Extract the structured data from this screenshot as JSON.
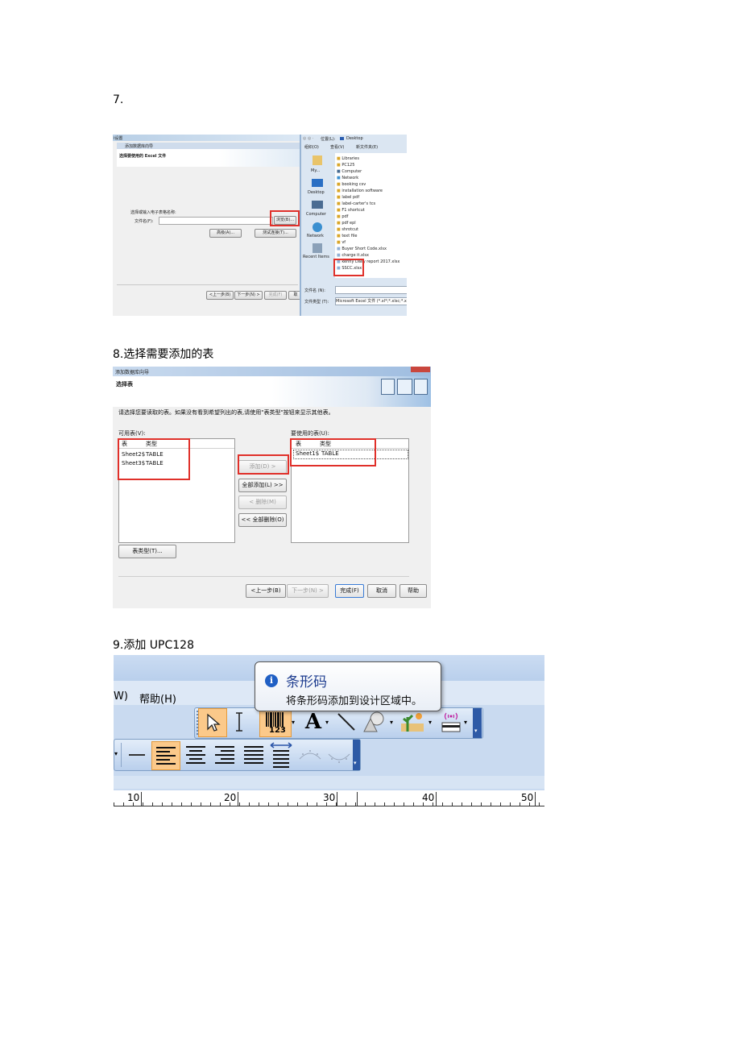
{
  "step7": {
    "label": "7.",
    "wizard": {
      "tab_fragment": "i设置",
      "title": "添加数据库向导",
      "heading": "选择要使用的 Excel 文件",
      "prompt": "选择或输入电子表格名称:",
      "filename_label": "文件名(F):",
      "browse": "浏览(B)...",
      "advanced": "高级(A)...",
      "test": "测试连接(T)...",
      "back": "<上一步(B)",
      "next": "下一步(N) >",
      "finish": "完成(F)",
      "cancel": "取"
    },
    "dialog": {
      "location_label": "位置(L):",
      "location": "Desktop",
      "organize": "组织(O)",
      "view": "查看(V)",
      "new_folder": "新文件夹(E)",
      "places": [
        "My...",
        "Desktop",
        "Computer",
        "Network",
        "Recent Items"
      ],
      "files": [
        "Libraries",
        "PC125",
        "Computer",
        "Network",
        "booking csv",
        "installation software",
        "label pdf",
        "label-carter's tcs",
        "F1 shortcut",
        "pdf",
        "pdf epl",
        "shrotcut",
        "text file",
        "vf",
        "Buyer Short Code.xlsx",
        "charge it.xlsx",
        "kenny Daily report 2017.xlsx",
        "SSCC.xlsx"
      ],
      "filename_label": "文件名 (N):",
      "filetype_label": "文件类型 (T):",
      "filetype": "Microsoft Excel 文件 (*.xl*;*.xlsc;*.xlsm)"
    }
  },
  "step8": {
    "label": "8.选择需要添加的表",
    "wizard": {
      "title": "添加数据库向导",
      "heading": "选择表",
      "instruction": "请选择您要读取的表。如果没有看到希望列出的表,请使用\"表类型\"按钮来显示其他表。",
      "available_label": "可用表(V):",
      "used_label": "要使用的表(U):",
      "col_table": "表",
      "col_type": "类型",
      "available_rows": [
        {
          "name": "Sheet2$",
          "type": "TABLE"
        },
        {
          "name": "Sheet3$",
          "type": "TABLE"
        }
      ],
      "used_rows": [
        {
          "name": "Sheet1$",
          "type": "TABLE"
        }
      ],
      "add": "添加(D) >",
      "add_all": "全部添加(L) >>",
      "remove": "< 删除(M)",
      "remove_all": "<< 全部删除(O)",
      "table_types": "表类型(T)...",
      "back": "<上一步(B)",
      "next": "下一步(N) >",
      "finish": "完成(F)",
      "cancel": "取消",
      "help": "帮助"
    }
  },
  "step9": {
    "label": "9.添加 UPC128",
    "menu_fragment": "W)",
    "menu_help": "帮助(H)",
    "tooltip_title": "条形码",
    "tooltip_desc": "将条形码添加到设计区域中。",
    "barcode_digits": "123",
    "ruler_labels": [
      "10",
      "20",
      "30",
      "40",
      "50"
    ]
  }
}
